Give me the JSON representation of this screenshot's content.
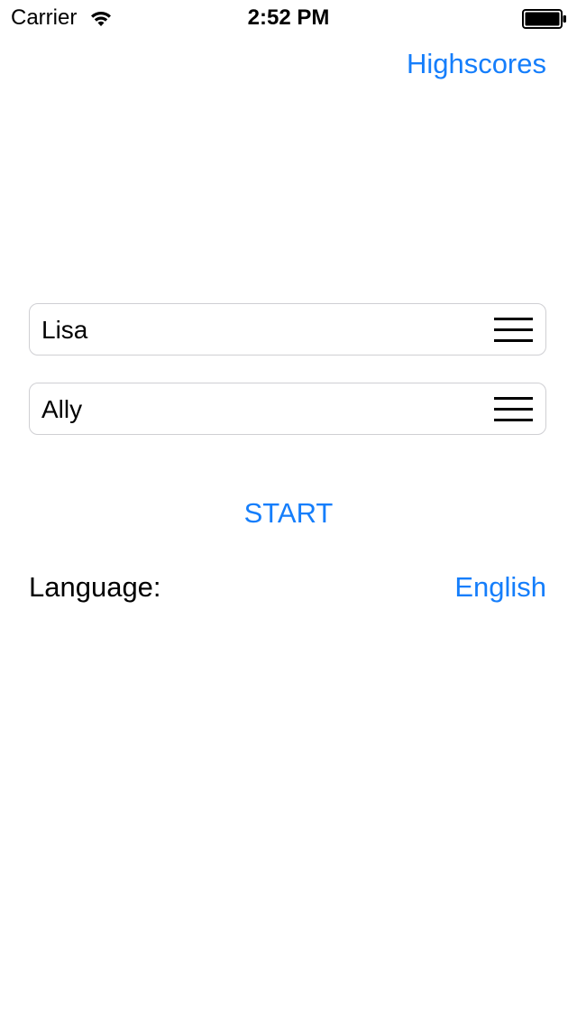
{
  "status_bar": {
    "carrier": "Carrier",
    "time": "2:52 PM",
    "wifi_icon": "wifi-icon",
    "battery_icon": "battery-full-icon"
  },
  "header": {
    "highscores_label": "Highscores"
  },
  "players": [
    {
      "name": "Lisa",
      "handle_icon": "reorder-handle-icon"
    },
    {
      "name": "Ally",
      "handle_icon": "reorder-handle-icon"
    }
  ],
  "actions": {
    "start_label": "START"
  },
  "language": {
    "label": "Language:",
    "value": "English"
  },
  "colors": {
    "accent": "#157efb",
    "text": "#000000",
    "border": "#cfcfd3",
    "background": "#ffffff"
  }
}
